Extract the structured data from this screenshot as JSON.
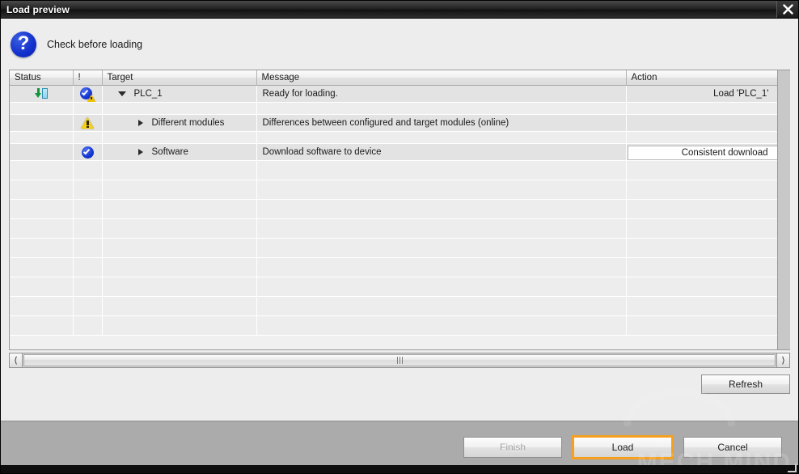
{
  "window": {
    "title": "Load preview",
    "close_icon": "close-icon"
  },
  "header": {
    "icon": "question-mark-icon",
    "icon_glyph": "?",
    "title": "Check before loading"
  },
  "table": {
    "columns": [
      "Status",
      "!",
      "Target",
      "Message",
      "Action"
    ],
    "rows": [
      {
        "status_icon": "download-arrow-icon",
        "severity_icon": "check-warning-icon",
        "expander": "triangle-down-icon",
        "indent": 1,
        "target": "PLC_1",
        "message": "Ready for loading.",
        "action": "Load 'PLC_1'",
        "action_style": "text"
      },
      {
        "status_icon": "",
        "severity_icon": "warning-triangle-icon",
        "expander": "triangle-right-icon",
        "indent": 2,
        "target": "Different modules",
        "message": "Differences between configured and target modules (online)",
        "action": "",
        "action_style": "text"
      },
      {
        "status_icon": "",
        "severity_icon": "check-circle-icon",
        "expander": "triangle-right-icon",
        "indent": 2,
        "target": "Software",
        "message": "Download software to device",
        "action": "Consistent download",
        "action_style": "combo"
      }
    ],
    "empty_row_count": 9
  },
  "scrollbar": {
    "left_arrow": "chevron-left-icon",
    "right_arrow": "chevron-right-icon",
    "grip": "grip-icon"
  },
  "buttons": {
    "refresh": "Refresh",
    "finish": "Finish",
    "finish_disabled": true,
    "load": "Load",
    "load_focused": true,
    "cancel": "Cancel"
  },
  "watermark": {
    "text": "MECH MIND"
  },
  "colors": {
    "accent_focus": "#f5a01e",
    "title_bar": "#1a1a1a",
    "dialog_bg": "#ededed",
    "footer_bg": "#ababab",
    "row_bg": "#e3e3e3",
    "warning": "#f5cf1a",
    "ok_blue": "#1436d2",
    "download_green": "#11953f"
  }
}
